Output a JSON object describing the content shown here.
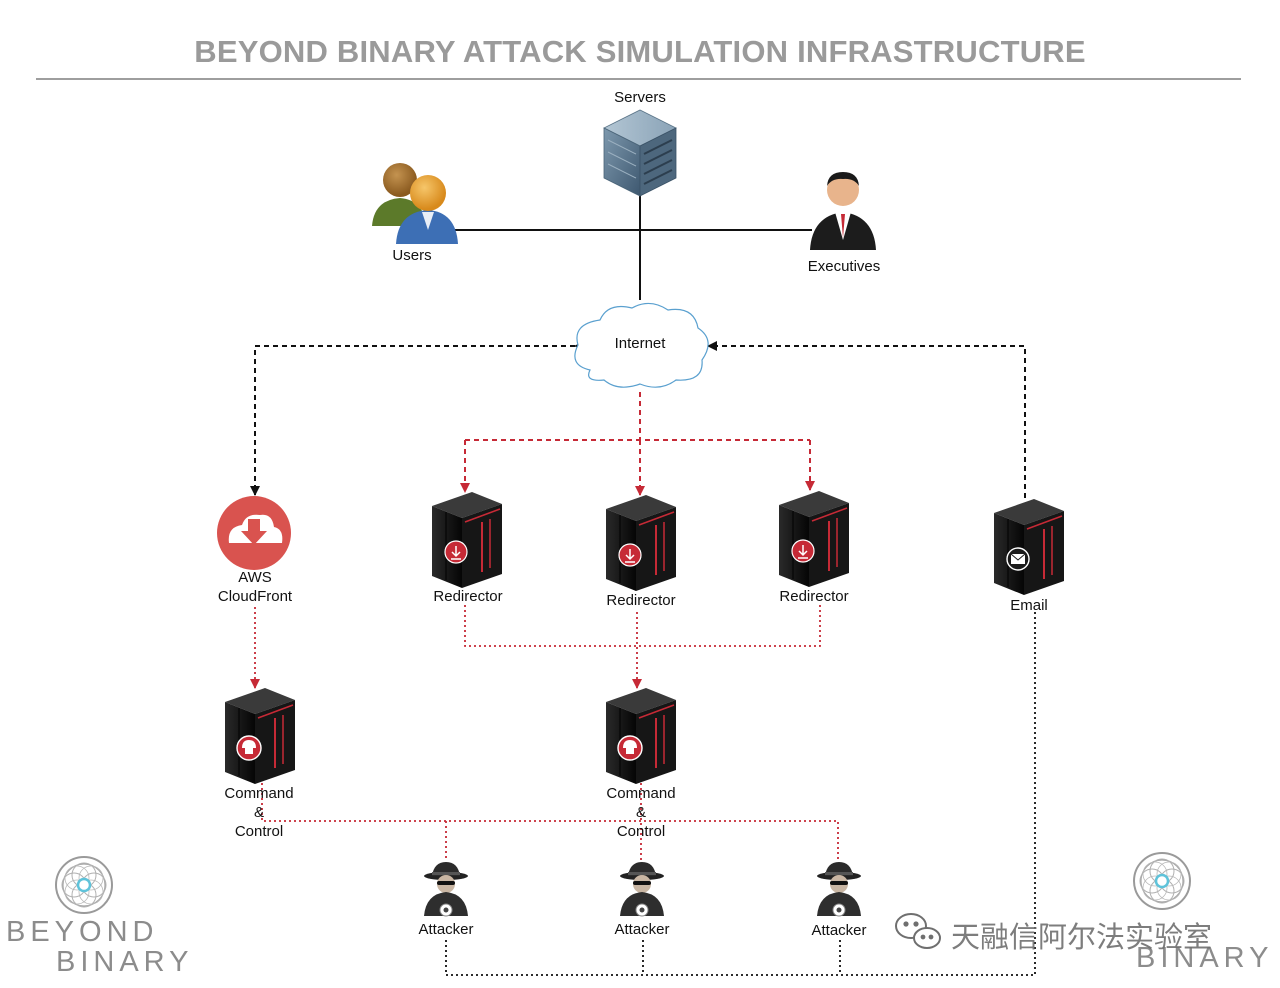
{
  "title": "BEYOND BINARY ATTACK SIMULATION INFRASTRUCTURE",
  "nodes": {
    "servers": "Servers",
    "users": "Users",
    "executives": "Executives",
    "internet": "Internet",
    "aws_line1": "AWS",
    "aws_line2": "CloudFront",
    "redirector_1": "Redirector",
    "redirector_2": "Redirector",
    "redirector_3": "Redirector",
    "email": "Email",
    "c2_left_line1": "Command",
    "c2_left_line2": "&",
    "c2_left_line3": "Control",
    "c2_center_line1": "Command",
    "c2_center_line2": "&",
    "c2_center_line3": "Control",
    "attacker_1": "Attacker",
    "attacker_2": "Attacker",
    "attacker_3": "Attacker"
  },
  "branding": {
    "left_line1": "BEYOND",
    "left_line2": "BINARY",
    "right_line2": "BINARY",
    "watermark": "天融信阿尔法实验室"
  },
  "colors": {
    "title": "#9a9a9a",
    "black_link": "#111111",
    "red_link": "#c62a36",
    "brand_gray": "#8c8c8c",
    "aws_red": "#d9534f"
  }
}
